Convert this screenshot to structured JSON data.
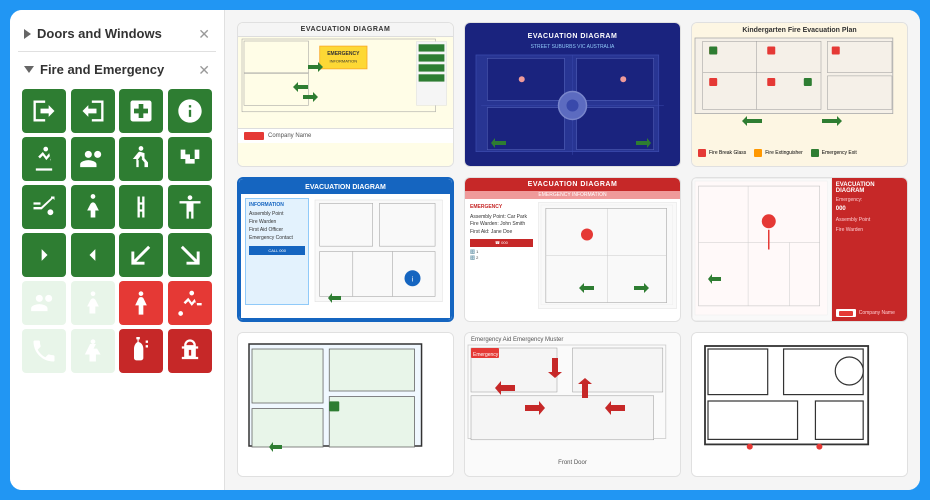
{
  "app": {
    "bg_color": "#2196F3"
  },
  "left_panel": {
    "sections": [
      {
        "id": "doors-windows",
        "label": "Doors and Windows",
        "collapsed": true,
        "icon": "triangle-right"
      },
      {
        "id": "fire-emergency",
        "label": "Fire and Emergency",
        "collapsed": false,
        "icon": "triangle-down"
      }
    ],
    "icons": [
      {
        "id": "exit-right",
        "title": "Exit Right"
      },
      {
        "id": "exit-left",
        "title": "Exit Left"
      },
      {
        "id": "first-aid",
        "title": "First Aid"
      },
      {
        "id": "safety-info",
        "title": "Safety Information"
      },
      {
        "id": "arrow-up-exit",
        "title": "Arrow Up Exit"
      },
      {
        "id": "arrow-up-exit2",
        "title": "Arrow Up Exit Alt"
      },
      {
        "id": "person-exit",
        "title": "Person Exiting"
      },
      {
        "id": "stairs-exit",
        "title": "Stairs Exit"
      },
      {
        "id": "escalator",
        "title": "Escalator"
      },
      {
        "id": "exit-person",
        "title": "Exit Person"
      },
      {
        "id": "ladder",
        "title": "Ladder"
      },
      {
        "id": "disabled",
        "title": "Disabled Access"
      },
      {
        "id": "arrow-right",
        "title": "Arrow Right"
      },
      {
        "id": "arrow-left",
        "title": "Arrow Left"
      },
      {
        "id": "arrow-down-left",
        "title": "Arrow Down Left"
      },
      {
        "id": "arrow-down-right",
        "title": "Arrow Down Right"
      },
      {
        "id": "assembly-point",
        "title": "Assembly Point"
      },
      {
        "id": "disabled2",
        "title": "Disabled"
      },
      {
        "id": "person-standing",
        "title": "Person Standing"
      },
      {
        "id": "person-running",
        "title": "Person Running"
      },
      {
        "id": "emergency-phone",
        "title": "Emergency Phone"
      },
      {
        "id": "disabled-person",
        "title": "Disabled Person"
      },
      {
        "id": "fire-extinguisher",
        "title": "Fire Extinguisher"
      },
      {
        "id": "fire-hydrant",
        "title": "Fire Hydrant"
      },
      {
        "id": "fire-hose",
        "title": "Fire Hose Reel"
      }
    ]
  },
  "right_panel": {
    "diagrams": [
      {
        "id": "diag1",
        "title": "EVACUATION DIAGRAM",
        "type": "yellow-floor-plan",
        "company": "Company Name"
      },
      {
        "id": "diag2",
        "title": "EVACUATION DIAGRAM",
        "subtitle": "STREET SUBURBS VIC AUSTRALIA",
        "type": "dark-blue-floor-plan"
      },
      {
        "id": "diag3",
        "title": "Kindergarten Fire Evacuation Plan",
        "type": "beige-floor-plan"
      },
      {
        "id": "diag4",
        "title": "EVACUATION DIAGRAM",
        "type": "white-blue-border"
      },
      {
        "id": "diag5",
        "title": "EVACUATION DIAGRAM",
        "subtitle": "EMERGENCY INFORMATION",
        "type": "red-header"
      },
      {
        "id": "diag6",
        "title": "EVACUATION DIAGRAM",
        "type": "red-right-panel",
        "company": "Company Name"
      },
      {
        "id": "diag7",
        "title": "",
        "type": "simple-floor-plan"
      },
      {
        "id": "diag8",
        "title": "Front Door",
        "type": "red-arrows",
        "subtitle": "Emergency Aid Emergency Muster"
      },
      {
        "id": "diag9",
        "title": "",
        "type": "black-outline"
      }
    ]
  }
}
